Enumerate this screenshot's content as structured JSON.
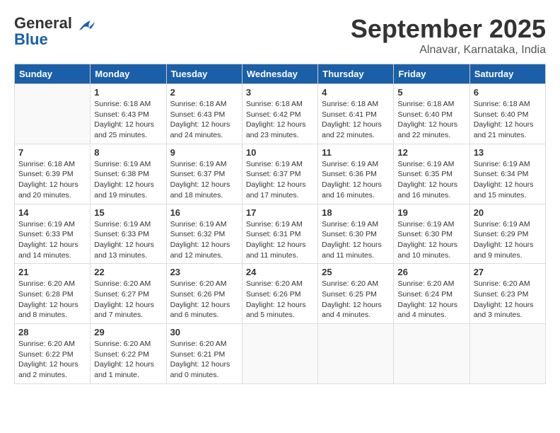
{
  "header": {
    "logo_line1": "General",
    "logo_line2": "Blue",
    "month": "September 2025",
    "location": "Alnavar, Karnataka, India"
  },
  "days_of_week": [
    "Sunday",
    "Monday",
    "Tuesday",
    "Wednesday",
    "Thursday",
    "Friday",
    "Saturday"
  ],
  "weeks": [
    [
      {
        "day": "",
        "info": ""
      },
      {
        "day": "1",
        "info": "Sunrise: 6:18 AM\nSunset: 6:43 PM\nDaylight: 12 hours\nand 25 minutes."
      },
      {
        "day": "2",
        "info": "Sunrise: 6:18 AM\nSunset: 6:43 PM\nDaylight: 12 hours\nand 24 minutes."
      },
      {
        "day": "3",
        "info": "Sunrise: 6:18 AM\nSunset: 6:42 PM\nDaylight: 12 hours\nand 23 minutes."
      },
      {
        "day": "4",
        "info": "Sunrise: 6:18 AM\nSunset: 6:41 PM\nDaylight: 12 hours\nand 22 minutes."
      },
      {
        "day": "5",
        "info": "Sunrise: 6:18 AM\nSunset: 6:40 PM\nDaylight: 12 hours\nand 22 minutes."
      },
      {
        "day": "6",
        "info": "Sunrise: 6:18 AM\nSunset: 6:40 PM\nDaylight: 12 hours\nand 21 minutes."
      }
    ],
    [
      {
        "day": "7",
        "info": "Sunrise: 6:18 AM\nSunset: 6:39 PM\nDaylight: 12 hours\nand 20 minutes."
      },
      {
        "day": "8",
        "info": "Sunrise: 6:19 AM\nSunset: 6:38 PM\nDaylight: 12 hours\nand 19 minutes."
      },
      {
        "day": "9",
        "info": "Sunrise: 6:19 AM\nSunset: 6:37 PM\nDaylight: 12 hours\nand 18 minutes."
      },
      {
        "day": "10",
        "info": "Sunrise: 6:19 AM\nSunset: 6:37 PM\nDaylight: 12 hours\nand 17 minutes."
      },
      {
        "day": "11",
        "info": "Sunrise: 6:19 AM\nSunset: 6:36 PM\nDaylight: 12 hours\nand 16 minutes."
      },
      {
        "day": "12",
        "info": "Sunrise: 6:19 AM\nSunset: 6:35 PM\nDaylight: 12 hours\nand 16 minutes."
      },
      {
        "day": "13",
        "info": "Sunrise: 6:19 AM\nSunset: 6:34 PM\nDaylight: 12 hours\nand 15 minutes."
      }
    ],
    [
      {
        "day": "14",
        "info": "Sunrise: 6:19 AM\nSunset: 6:33 PM\nDaylight: 12 hours\nand 14 minutes."
      },
      {
        "day": "15",
        "info": "Sunrise: 6:19 AM\nSunset: 6:33 PM\nDaylight: 12 hours\nand 13 minutes."
      },
      {
        "day": "16",
        "info": "Sunrise: 6:19 AM\nSunset: 6:32 PM\nDaylight: 12 hours\nand 12 minutes."
      },
      {
        "day": "17",
        "info": "Sunrise: 6:19 AM\nSunset: 6:31 PM\nDaylight: 12 hours\nand 11 minutes."
      },
      {
        "day": "18",
        "info": "Sunrise: 6:19 AM\nSunset: 6:30 PM\nDaylight: 12 hours\nand 11 minutes."
      },
      {
        "day": "19",
        "info": "Sunrise: 6:19 AM\nSunset: 6:30 PM\nDaylight: 12 hours\nand 10 minutes."
      },
      {
        "day": "20",
        "info": "Sunrise: 6:19 AM\nSunset: 6:29 PM\nDaylight: 12 hours\nand 9 minutes."
      }
    ],
    [
      {
        "day": "21",
        "info": "Sunrise: 6:20 AM\nSunset: 6:28 PM\nDaylight: 12 hours\nand 8 minutes."
      },
      {
        "day": "22",
        "info": "Sunrise: 6:20 AM\nSunset: 6:27 PM\nDaylight: 12 hours\nand 7 minutes."
      },
      {
        "day": "23",
        "info": "Sunrise: 6:20 AM\nSunset: 6:26 PM\nDaylight: 12 hours\nand 6 minutes."
      },
      {
        "day": "24",
        "info": "Sunrise: 6:20 AM\nSunset: 6:26 PM\nDaylight: 12 hours\nand 5 minutes."
      },
      {
        "day": "25",
        "info": "Sunrise: 6:20 AM\nSunset: 6:25 PM\nDaylight: 12 hours\nand 4 minutes."
      },
      {
        "day": "26",
        "info": "Sunrise: 6:20 AM\nSunset: 6:24 PM\nDaylight: 12 hours\nand 4 minutes."
      },
      {
        "day": "27",
        "info": "Sunrise: 6:20 AM\nSunset: 6:23 PM\nDaylight: 12 hours\nand 3 minutes."
      }
    ],
    [
      {
        "day": "28",
        "info": "Sunrise: 6:20 AM\nSunset: 6:22 PM\nDaylight: 12 hours\nand 2 minutes."
      },
      {
        "day": "29",
        "info": "Sunrise: 6:20 AM\nSunset: 6:22 PM\nDaylight: 12 hours\nand 1 minute."
      },
      {
        "day": "30",
        "info": "Sunrise: 6:20 AM\nSunset: 6:21 PM\nDaylight: 12 hours\nand 0 minutes."
      },
      {
        "day": "",
        "info": ""
      },
      {
        "day": "",
        "info": ""
      },
      {
        "day": "",
        "info": ""
      },
      {
        "day": "",
        "info": ""
      }
    ]
  ]
}
